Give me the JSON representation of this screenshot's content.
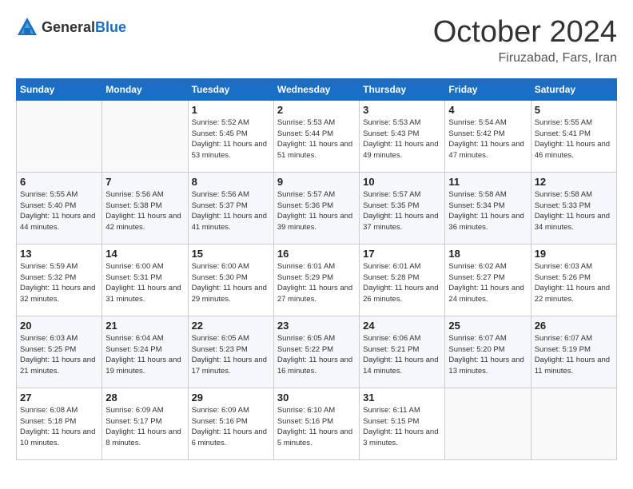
{
  "header": {
    "logo_general": "General",
    "logo_blue": "Blue",
    "month": "October 2024",
    "location": "Firuzabad, Fars, Iran"
  },
  "weekdays": [
    "Sunday",
    "Monday",
    "Tuesday",
    "Wednesday",
    "Thursday",
    "Friday",
    "Saturday"
  ],
  "weeks": [
    [
      {
        "day": "",
        "info": ""
      },
      {
        "day": "",
        "info": ""
      },
      {
        "day": "1",
        "info": "Sunrise: 5:52 AM\nSunset: 5:45 PM\nDaylight: 11 hours and 53 minutes."
      },
      {
        "day": "2",
        "info": "Sunrise: 5:53 AM\nSunset: 5:44 PM\nDaylight: 11 hours and 51 minutes."
      },
      {
        "day": "3",
        "info": "Sunrise: 5:53 AM\nSunset: 5:43 PM\nDaylight: 11 hours and 49 minutes."
      },
      {
        "day": "4",
        "info": "Sunrise: 5:54 AM\nSunset: 5:42 PM\nDaylight: 11 hours and 47 minutes."
      },
      {
        "day": "5",
        "info": "Sunrise: 5:55 AM\nSunset: 5:41 PM\nDaylight: 11 hours and 46 minutes."
      }
    ],
    [
      {
        "day": "6",
        "info": "Sunrise: 5:55 AM\nSunset: 5:40 PM\nDaylight: 11 hours and 44 minutes."
      },
      {
        "day": "7",
        "info": "Sunrise: 5:56 AM\nSunset: 5:38 PM\nDaylight: 11 hours and 42 minutes."
      },
      {
        "day": "8",
        "info": "Sunrise: 5:56 AM\nSunset: 5:37 PM\nDaylight: 11 hours and 41 minutes."
      },
      {
        "day": "9",
        "info": "Sunrise: 5:57 AM\nSunset: 5:36 PM\nDaylight: 11 hours and 39 minutes."
      },
      {
        "day": "10",
        "info": "Sunrise: 5:57 AM\nSunset: 5:35 PM\nDaylight: 11 hours and 37 minutes."
      },
      {
        "day": "11",
        "info": "Sunrise: 5:58 AM\nSunset: 5:34 PM\nDaylight: 11 hours and 36 minutes."
      },
      {
        "day": "12",
        "info": "Sunrise: 5:58 AM\nSunset: 5:33 PM\nDaylight: 11 hours and 34 minutes."
      }
    ],
    [
      {
        "day": "13",
        "info": "Sunrise: 5:59 AM\nSunset: 5:32 PM\nDaylight: 11 hours and 32 minutes."
      },
      {
        "day": "14",
        "info": "Sunrise: 6:00 AM\nSunset: 5:31 PM\nDaylight: 11 hours and 31 minutes."
      },
      {
        "day": "15",
        "info": "Sunrise: 6:00 AM\nSunset: 5:30 PM\nDaylight: 11 hours and 29 minutes."
      },
      {
        "day": "16",
        "info": "Sunrise: 6:01 AM\nSunset: 5:29 PM\nDaylight: 11 hours and 27 minutes."
      },
      {
        "day": "17",
        "info": "Sunrise: 6:01 AM\nSunset: 5:28 PM\nDaylight: 11 hours and 26 minutes."
      },
      {
        "day": "18",
        "info": "Sunrise: 6:02 AM\nSunset: 5:27 PM\nDaylight: 11 hours and 24 minutes."
      },
      {
        "day": "19",
        "info": "Sunrise: 6:03 AM\nSunset: 5:26 PM\nDaylight: 11 hours and 22 minutes."
      }
    ],
    [
      {
        "day": "20",
        "info": "Sunrise: 6:03 AM\nSunset: 5:25 PM\nDaylight: 11 hours and 21 minutes."
      },
      {
        "day": "21",
        "info": "Sunrise: 6:04 AM\nSunset: 5:24 PM\nDaylight: 11 hours and 19 minutes."
      },
      {
        "day": "22",
        "info": "Sunrise: 6:05 AM\nSunset: 5:23 PM\nDaylight: 11 hours and 17 minutes."
      },
      {
        "day": "23",
        "info": "Sunrise: 6:05 AM\nSunset: 5:22 PM\nDaylight: 11 hours and 16 minutes."
      },
      {
        "day": "24",
        "info": "Sunrise: 6:06 AM\nSunset: 5:21 PM\nDaylight: 11 hours and 14 minutes."
      },
      {
        "day": "25",
        "info": "Sunrise: 6:07 AM\nSunset: 5:20 PM\nDaylight: 11 hours and 13 minutes."
      },
      {
        "day": "26",
        "info": "Sunrise: 6:07 AM\nSunset: 5:19 PM\nDaylight: 11 hours and 11 minutes."
      }
    ],
    [
      {
        "day": "27",
        "info": "Sunrise: 6:08 AM\nSunset: 5:18 PM\nDaylight: 11 hours and 10 minutes."
      },
      {
        "day": "28",
        "info": "Sunrise: 6:09 AM\nSunset: 5:17 PM\nDaylight: 11 hours and 8 minutes."
      },
      {
        "day": "29",
        "info": "Sunrise: 6:09 AM\nSunset: 5:16 PM\nDaylight: 11 hours and 6 minutes."
      },
      {
        "day": "30",
        "info": "Sunrise: 6:10 AM\nSunset: 5:16 PM\nDaylight: 11 hours and 5 minutes."
      },
      {
        "day": "31",
        "info": "Sunrise: 6:11 AM\nSunset: 5:15 PM\nDaylight: 11 hours and 3 minutes."
      },
      {
        "day": "",
        "info": ""
      },
      {
        "day": "",
        "info": ""
      }
    ]
  ]
}
